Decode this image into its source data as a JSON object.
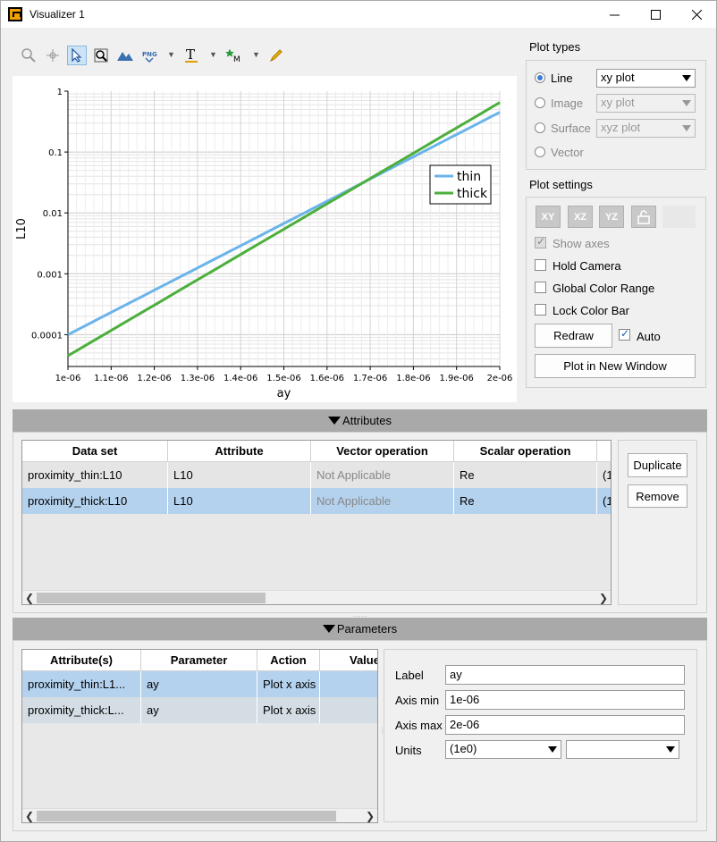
{
  "window": {
    "title": "Visualizer 1"
  },
  "plot": {
    "chart_data": {
      "type": "line",
      "title": "",
      "xlabel": "ay",
      "ylabel": "L10",
      "y_scale": "log",
      "xlim": [
        1e-06,
        2e-06
      ],
      "ylim": [
        3e-05,
        1
      ],
      "x_ticks": [
        "1e-06",
        "1.1e-06",
        "1.2e-06",
        "1.3e-06",
        "1.4e-06",
        "1.5e-06",
        "1.6e-06",
        "1.7e-06",
        "1.8e-06",
        "1.9e-06",
        "2e-06"
      ],
      "y_ticks": [
        "1",
        "0.1",
        "0.01",
        "0.001",
        "0.0001"
      ],
      "grid": true,
      "legend_position": "right",
      "series": [
        {
          "name": "thin",
          "color": "#6ab4ea",
          "x": [
            1e-06,
            2e-06
          ],
          "y": [
            0.0001,
            0.45
          ]
        },
        {
          "name": "thick",
          "color": "#4caf3c",
          "x": [
            1e-06,
            2e-06
          ],
          "y": [
            4.5e-05,
            0.65
          ]
        }
      ]
    }
  },
  "plot_types": {
    "title": "Plot types",
    "line": {
      "label": "Line",
      "combo": "xy plot"
    },
    "image": {
      "label": "Image",
      "combo": "xy plot"
    },
    "surface": {
      "label": "Surface",
      "combo": "xyz plot"
    },
    "vector": {
      "label": "Vector"
    }
  },
  "plot_settings": {
    "title": "Plot settings",
    "view_buttons": [
      "XY",
      "XZ",
      "YZ"
    ],
    "show_axes": "Show axes",
    "hold_camera": "Hold Camera",
    "global_color_range": "Global Color Range",
    "lock_color_bar": "Lock Color Bar",
    "redraw": "Redraw",
    "auto": "Auto",
    "plot_new_window": "Plot in New Window"
  },
  "attributes": {
    "title": "Attributes",
    "columns": [
      "Data set",
      "Attribute",
      "Vector operation",
      "Scalar operation"
    ],
    "rows": [
      {
        "dataset": "proximity_thin:L10",
        "attribute": "L10",
        "vector_op": "Not Applicable",
        "scalar_op": "Re",
        "extra": "(1"
      },
      {
        "dataset": "proximity_thick:L10",
        "attribute": "L10",
        "vector_op": "Not Applicable",
        "scalar_op": "Re",
        "extra": "(1"
      }
    ],
    "duplicate": "Duplicate",
    "remove": "Remove"
  },
  "parameters": {
    "title": "Parameters",
    "columns": [
      "Attribute(s)",
      "Parameter",
      "Action",
      "Value"
    ],
    "rows": [
      {
        "attr": "proximity_thin:L1...",
        "param": "ay",
        "action": "Plot x axis"
      },
      {
        "attr": "proximity_thick:L...",
        "param": "ay",
        "action": "Plot x axis"
      }
    ],
    "label_lbl": "Label",
    "label_val": "ay",
    "axis_min_lbl": "Axis min",
    "axis_min_val": "1e-06",
    "axis_max_lbl": "Axis max",
    "axis_max_val": "2e-06",
    "units_lbl": "Units",
    "units_val": "(1e0)"
  }
}
